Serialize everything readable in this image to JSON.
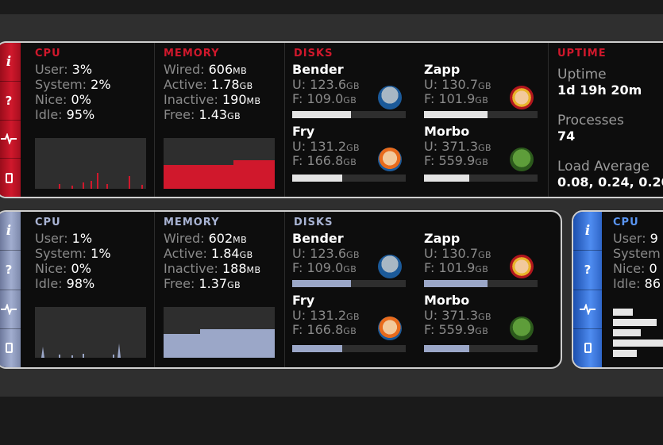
{
  "colors": {
    "red_accent": "#d0182c",
    "slate_accent": "#a2aed0",
    "blue_accent": "#4f8cf0"
  },
  "icons": {
    "info": "i",
    "help": "?",
    "pulse": "pulse-icon",
    "battery": "battery-icon"
  },
  "w1": {
    "cpu": {
      "title": "CPU",
      "user_l": "User:",
      "user_v": "3%",
      "system_l": "System:",
      "system_v": "2%",
      "nice_l": "Nice:",
      "nice_v": "0%",
      "idle_l": "Idle:",
      "idle_v": "95%"
    },
    "mem": {
      "title": "MEMORY",
      "wired_l": "Wired:",
      "wired_v": "606",
      "wired_u": "MB",
      "active_l": "Active:",
      "active_v": "1.78",
      "active_u": "GB",
      "inactive_l": "Inactive:",
      "inactive_v": "190",
      "inactive_u": "MB",
      "free_l": "Free:",
      "free_v": "1.43",
      "free_u": "GB"
    },
    "disks": {
      "title": "DISKS",
      "bender": {
        "name": "Bender",
        "u": "U: 123.6",
        "u_unit": "GB",
        "f": "F: 109.0",
        "f_unit": "GB",
        "fill": 0.52
      },
      "fry": {
        "name": "Fry",
        "u": "U: 131.2",
        "u_unit": "GB",
        "f": "F: 166.8",
        "f_unit": "GB",
        "fill": 0.44
      },
      "zapp": {
        "name": "Zapp",
        "u": "U: 130.7",
        "u_unit": "GB",
        "f": "F: 101.9",
        "f_unit": "GB",
        "fill": 0.56
      },
      "morbo": {
        "name": "Morbo",
        "u": "U: 371.3",
        "u_unit": "GB",
        "f": "F: 559.9",
        "f_unit": "GB",
        "fill": 0.4
      }
    },
    "uptime": {
      "title": "UPTIME",
      "uptime_l": "Uptime",
      "uptime_v": "1d 19h 20m",
      "proc_l": "Processes",
      "proc_v": "74",
      "load_l": "Load Average",
      "load_v": "0.08, 0.24, 0.20"
    }
  },
  "w2": {
    "cpu": {
      "title": "CPU",
      "user_l": "User:",
      "user_v": "1%",
      "system_l": "System:",
      "system_v": "1%",
      "nice_l": "Nice:",
      "nice_v": "0%",
      "idle_l": "Idle:",
      "idle_v": "98%"
    },
    "mem": {
      "title": "MEMORY",
      "wired_l": "Wired:",
      "wired_v": "602",
      "wired_u": "MB",
      "active_l": "Active:",
      "active_v": "1.84",
      "active_u": "GB",
      "inactive_l": "Inactive:",
      "inactive_v": "188",
      "inactive_u": "MB",
      "free_l": "Free:",
      "free_v": "1.37",
      "free_u": "GB"
    },
    "disks": {
      "title": "DISKS",
      "bender": {
        "name": "Bender",
        "u": "U: 123.6",
        "u_unit": "GB",
        "f": "F: 109.0",
        "f_unit": "GB",
        "fill": 0.52
      },
      "fry": {
        "name": "Fry",
        "u": "U: 131.2",
        "u_unit": "GB",
        "f": "F: 166.8",
        "f_unit": "GB",
        "fill": 0.44
      },
      "zapp": {
        "name": "Zapp",
        "u": "U: 130.7",
        "u_unit": "GB",
        "f": "F: 101.9",
        "f_unit": "GB",
        "fill": 0.56
      },
      "morbo": {
        "name": "Morbo",
        "u": "U: 371.3",
        "u_unit": "GB",
        "f": "F: 559.9",
        "f_unit": "GB",
        "fill": 0.4
      }
    }
  },
  "w3": {
    "cpu": {
      "title": "CPU",
      "user_l": "User:",
      "user_v": "9",
      "system_l": "System",
      "nice_l": "Nice:",
      "nice_v": "0",
      "idle_l": "Idle:",
      "idle_v": "86"
    },
    "bars": [
      0.25,
      0.55,
      0.35,
      0.7,
      0.3
    ]
  }
}
